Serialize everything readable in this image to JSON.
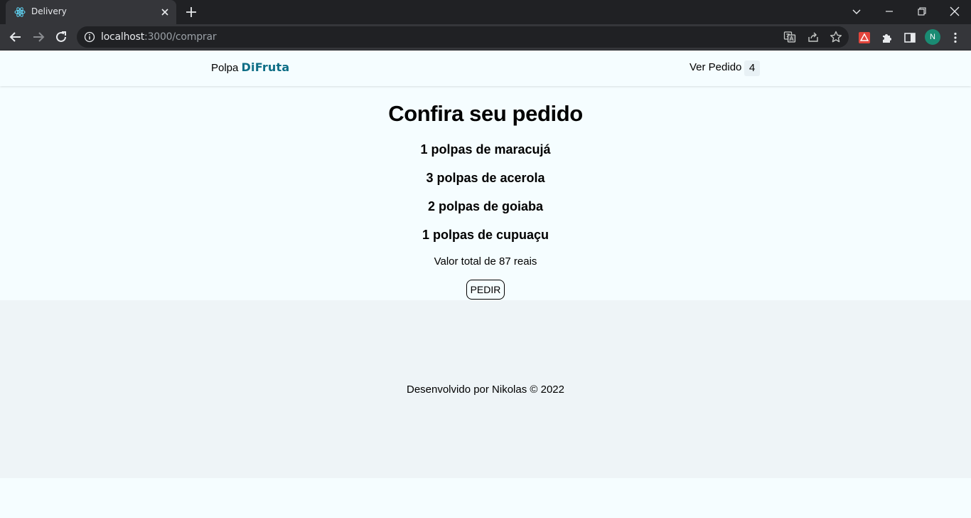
{
  "browser": {
    "tab_title": "Delivery",
    "url_host": "localhost",
    "url_path": ":3000/comprar",
    "profile_initial": "N"
  },
  "navbar": {
    "brand_prefix": "Polpa",
    "brand_accent": "DiFruta",
    "order_link": "Ver Pedido",
    "order_count": "4"
  },
  "order": {
    "title": "Confira seu pedido",
    "items": [
      "1 polpas de maracujá",
      "3 polpas de acerola",
      "2 polpas de goiaba",
      "1 polpas de cupuaçu"
    ],
    "total": "Valor total de 87 reais",
    "button_label": "PEDIR"
  },
  "footer": {
    "text": "Desenvolvido por Nikolas © 2022"
  },
  "colors": {
    "page_bg": "#f5fdff",
    "footer_bg": "#eef4f7",
    "brand_accent": "#0e6e86",
    "profile_bg": "#1a8b73"
  }
}
